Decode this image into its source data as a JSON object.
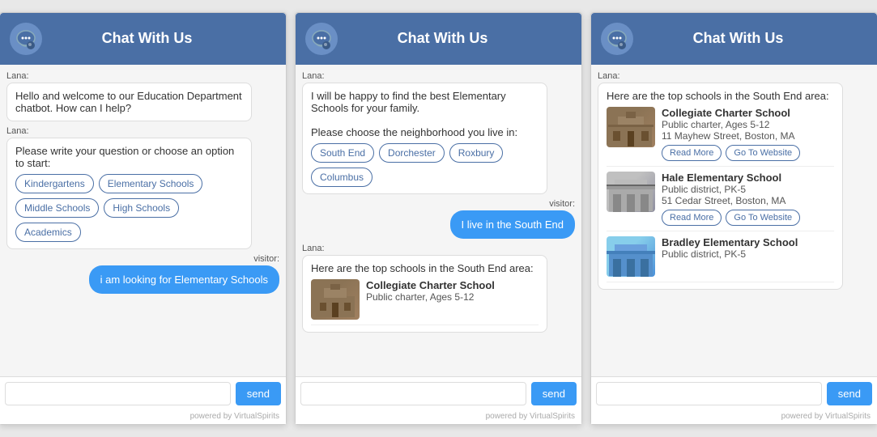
{
  "widgets": [
    {
      "id": "widget1",
      "header": {
        "title": "Chat With Us"
      },
      "messages": [
        {
          "type": "bot",
          "sender": "Lana:",
          "text": "Hello and welcome to our Education Department chatbot. How can I help?"
        },
        {
          "type": "bot",
          "sender": "Lana:",
          "text": "Please write your question or choose an option to start:",
          "options": [
            "Kindergartens",
            "Elementary Schools",
            "Middle Schools",
            "High Schools",
            "Academics"
          ]
        },
        {
          "type": "visitor",
          "sender": "visitor:",
          "text": "i am looking for Elementary Schools"
        }
      ],
      "input_placeholder": "",
      "send_label": "send",
      "footer": "powered by VirtualSpirits"
    },
    {
      "id": "widget2",
      "header": {
        "title": "Chat With Us"
      },
      "messages": [
        {
          "type": "bot",
          "sender": "Lana:",
          "text": "I will be happy to find the best Elementary Schools for your family.\n\nPlease choose the neighborhood you live in:",
          "options": [
            "South End",
            "Dorchester",
            "Roxbury",
            "Columbus"
          ]
        },
        {
          "type": "visitor",
          "sender": "visitor:",
          "text": "I live in the South End"
        },
        {
          "type": "bot",
          "sender": "Lana:",
          "text": "Here are the top schools in the South End area:",
          "school_preview": {
            "name": "Collegiate Charter School",
            "type": "Public charter, Ages 5-12"
          }
        }
      ],
      "input_placeholder": "",
      "send_label": "send",
      "footer": "powered by VirtualSpirits"
    },
    {
      "id": "widget3",
      "header": {
        "title": "Chat With Us"
      },
      "messages": [
        {
          "type": "bot",
          "sender": "Lana:",
          "text": "Here are the top schools in the South End area:",
          "schools": [
            {
              "name": "Collegiate Charter School",
              "type": "Public charter, Ages 5-12",
              "address": "11 Mayhew Street, Boston, MA",
              "img_class": "img-collegiate",
              "read_more": "Read More",
              "go_to_website": "Go To Website"
            },
            {
              "name": "Hale Elementary School",
              "type": "Public district, PK-5",
              "address": "51 Cedar Street, Boston, MA",
              "img_class": "img-hale",
              "read_more": "Read More",
              "go_to_website": "Go To Website"
            },
            {
              "name": "Bradley Elementary School",
              "type": "Public district, PK-5",
              "address": "",
              "img_class": "img-bradley",
              "read_more": "",
              "go_to_website": ""
            }
          ]
        }
      ],
      "input_placeholder": "",
      "send_label": "send",
      "footer": "powered by VirtualSpirits"
    }
  ]
}
